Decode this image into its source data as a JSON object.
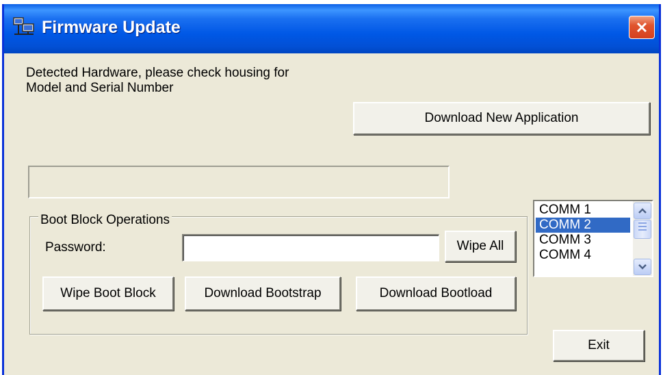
{
  "window": {
    "title": "Firmware Update",
    "title_icon": "computer-network-icon",
    "close_icon": "close-icon",
    "close_color": "#e0552f",
    "titlebar_color": "#0058e6"
  },
  "info": {
    "line1": "Detected Hardware, please check housing for",
    "line2": "Model and Serial Number"
  },
  "buttons": {
    "download_app": "Download New Application",
    "wipe_all": "Wipe All",
    "wipe_boot_block": "Wipe Boot Block",
    "download_bootstrap": "Download Bootstrap",
    "download_bootload": "Download Bootload",
    "exit": "Exit"
  },
  "progress": {
    "value": 0
  },
  "boot_block": {
    "label": "Boot Block Operations",
    "password_label": "Password:",
    "password_value": ""
  },
  "comm_ports": {
    "items": [
      "COMM 1",
      "COMM 2",
      "COMM 3",
      "COMM 4"
    ],
    "selected": "COMM 2",
    "selected_color": "#316ac5"
  }
}
